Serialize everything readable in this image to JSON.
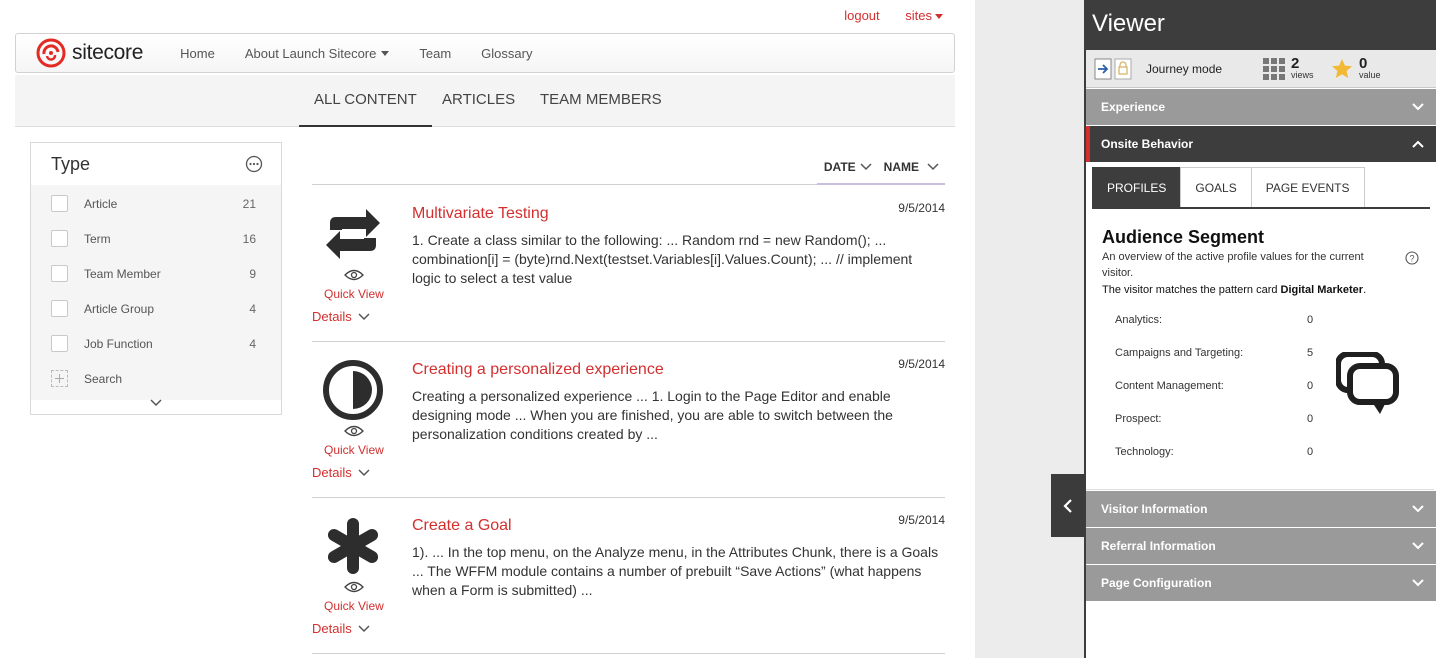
{
  "toplinks": {
    "logout": "logout",
    "sites": "sites"
  },
  "nav": {
    "brand": "sitecore",
    "items": [
      "Home",
      "About Launch Sitecore",
      "Team",
      "Glossary"
    ]
  },
  "tabs": [
    "ALL CONTENT",
    "ARTICLES",
    "TEAM MEMBERS"
  ],
  "type_filter": {
    "title": "Type",
    "items": [
      {
        "label": "Article",
        "count": "21"
      },
      {
        "label": "Term",
        "count": "16"
      },
      {
        "label": "Team Member",
        "count": "9"
      },
      {
        "label": "Article Group",
        "count": "4"
      },
      {
        "label": "Job Function",
        "count": "4"
      }
    ],
    "search_label": "Search"
  },
  "sort": {
    "date": "DATE",
    "name": "NAME"
  },
  "results": [
    {
      "title": "Multivariate Testing",
      "date": "9/5/2014",
      "description": "1. Create a class similar to the following: ... Random rnd = new Random(); ... combination[i] = (byte)rnd.Next(testset.Variables[i].Values.Count); ... // implement logic to select a test value",
      "quick_view": "Quick View",
      "details": "Details",
      "icon": "refresh-arrows-icon"
    },
    {
      "title": "Creating a personalized experience",
      "date": "9/5/2014",
      "description": "Creating a personalized experience ... 1. Login to the Page Editor and enable designing mode ... When you are finished, you are able to switch between the personalization conditions created by ...",
      "quick_view": "Quick View",
      "details": "Details",
      "icon": "half-circle-icon"
    },
    {
      "title": "Create a Goal",
      "date": "9/5/2014",
      "description": "1). ... In the top menu, on the Analyze menu, in the Attributes Chunk, there is a Goals ... The WFFM module contains a number of prebuilt “Save Actions” (what happens when a Form is submitted) ...",
      "quick_view": "Quick View",
      "details": "Details",
      "icon": "asterisk-icon"
    }
  ],
  "viewer": {
    "title": "Viewer",
    "journey_mode": "Journey mode",
    "views_count": "2",
    "views_label": "views",
    "value_count": "0",
    "value_label": "value",
    "sections": {
      "experience": "Experience",
      "onsite": "Onsite Behavior",
      "visitor": "Visitor Information",
      "referral": "Referral Information",
      "page_config": "Page Configuration"
    },
    "profile_tabs": [
      "PROFILES",
      "GOALS",
      "PAGE EVENTS"
    ],
    "audience_title": "Audience Segment",
    "audience_desc": "An overview of the active profile values for the current visitor.",
    "matches_prefix": "The visitor matches the pattern card ",
    "matches_card": "Digital Marketer",
    "matches_suffix": ".",
    "profiles": [
      {
        "label": "Analytics:",
        "value": "0"
      },
      {
        "label": "Campaigns and Targeting:",
        "value": "5"
      },
      {
        "label": "Content Management:",
        "value": "0"
      },
      {
        "label": "Prospect:",
        "value": "0"
      },
      {
        "label": "Technology:",
        "value": "0"
      }
    ]
  },
  "colors": {
    "accent": "#d32f2f",
    "dark": "#3d3d3d",
    "section_gray": "#9a9a9a"
  }
}
